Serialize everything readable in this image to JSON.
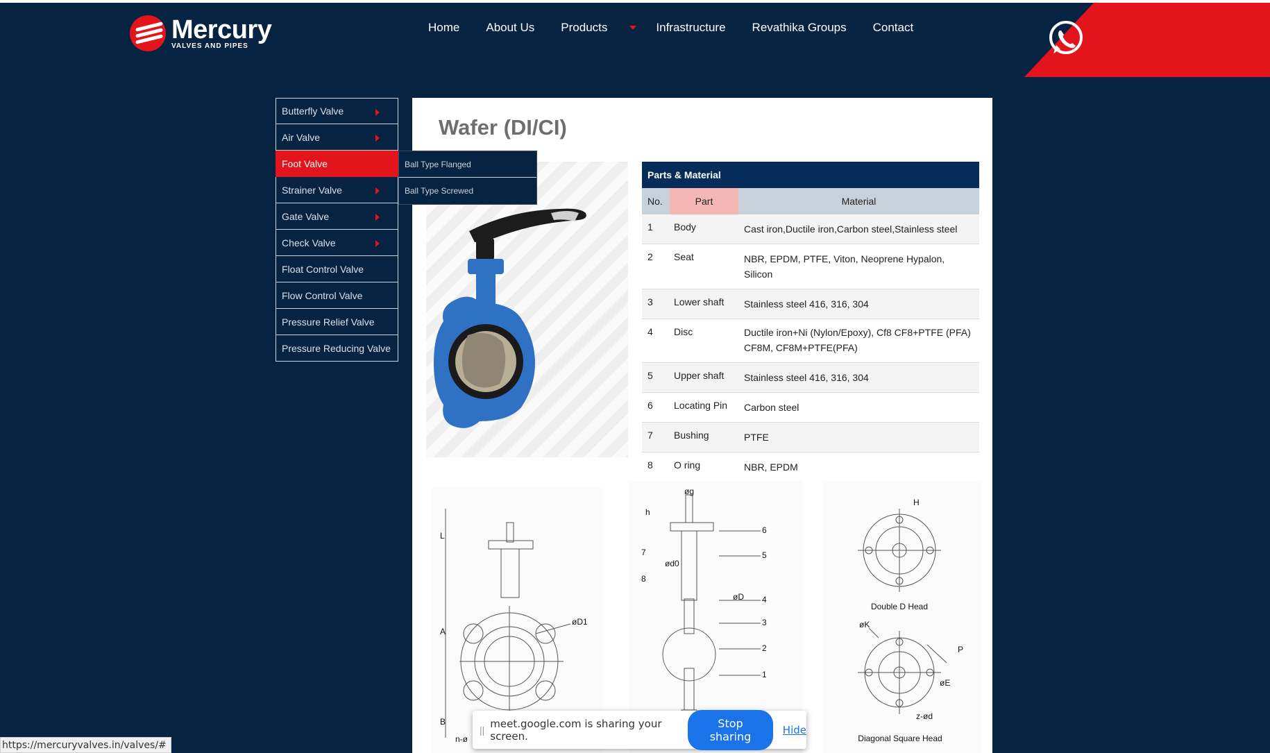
{
  "header": {
    "logo_name": "Mercury",
    "logo_sub": "VALVES AND PIPES",
    "nav": [
      "Home",
      "About Us",
      "Products",
      "Infrastructure",
      "Revathika Groups",
      "Contact"
    ]
  },
  "side_menu": [
    {
      "label": "Butterfly Valve",
      "has_sub": true
    },
    {
      "label": "Air Valve",
      "has_sub": true
    },
    {
      "label": "Foot Valve",
      "has_sub": false,
      "active": true
    },
    {
      "label": "Strainer Valve",
      "has_sub": true
    },
    {
      "label": "Gate Valve",
      "has_sub": true
    },
    {
      "label": "Check Valve",
      "has_sub": true
    },
    {
      "label": "Float Control Valve",
      "has_sub": false
    },
    {
      "label": "Flow Control Valve",
      "has_sub": false
    },
    {
      "label": "Pressure Relief Valve",
      "has_sub": false
    },
    {
      "label": "Pressure Reducing Valve",
      "has_sub": false
    }
  ],
  "submenu": [
    "Ball Type Flanged",
    "Ball Type Screwed"
  ],
  "content": {
    "title": "Wafer (DI/CI)",
    "table_title": "Parts & Material",
    "columns": {
      "no": "No.",
      "part": "Part",
      "material": "Material"
    },
    "rows": [
      {
        "no": "1",
        "part": "Body",
        "material": "Cast iron,Ductile iron,Carbon steel,Stainless steel"
      },
      {
        "no": "2",
        "part": "Seat",
        "material": "NBR, EPDM, PTFE, Viton, Neoprene Hypalon, Silicon"
      },
      {
        "no": "3",
        "part": "Lower shaft",
        "material": "Stainless steel 416, 316, 304"
      },
      {
        "no": "4",
        "part": "Disc",
        "material": "Ductile iron+Ni (Nylon/Epoxy), Cf8 CF8+PTFE (PFA) CF8M, CF8M+PTFE(PFA)"
      },
      {
        "no": "5",
        "part": "Upper shaft",
        "material": "Stainless steel 416, 316, 304"
      },
      {
        "no": "6",
        "part": "Locating Pin",
        "material": "Carbon steel"
      },
      {
        "no": "7",
        "part": "Bushing",
        "material": "PTFE"
      },
      {
        "no": "8",
        "part": "O ring",
        "material": "NBR, EPDM"
      }
    ],
    "captions": {
      "double_d": "Double D Head",
      "diagonal": "Diagonal Square Head"
    },
    "drawing_labels": {
      "d1": [
        "L",
        "A",
        "B",
        "øD1",
        "n-ø"
      ],
      "d2": [
        "øg",
        "h",
        "7",
        "8",
        "ød0",
        "6",
        "5",
        "øD",
        "4",
        "3",
        "2",
        "1"
      ],
      "d3": [
        "H",
        "øK",
        "P",
        "øE",
        "z-ød"
      ]
    }
  },
  "status": {
    "url": "https://mercuryvalves.in/valves/#"
  },
  "share": {
    "text": "meet.google.com is sharing your screen.",
    "stop": "Stop sharing",
    "hide": "Hide"
  }
}
